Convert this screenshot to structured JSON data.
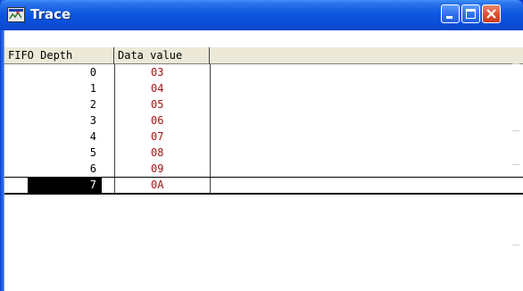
{
  "window": {
    "title": "Trace",
    "icon": "trace-window-icon",
    "buttons": [
      "minimize",
      "maximize",
      "close"
    ]
  },
  "table": {
    "columns": [
      "FIFO Depth",
      "Data value"
    ],
    "rows": [
      {
        "depth": "0",
        "value": "03"
      },
      {
        "depth": "1",
        "value": "04"
      },
      {
        "depth": "2",
        "value": "05"
      },
      {
        "depth": "3",
        "value": "06"
      },
      {
        "depth": "4",
        "value": "07"
      },
      {
        "depth": "5",
        "value": "08"
      },
      {
        "depth": "6",
        "value": "09"
      },
      {
        "depth": "7",
        "value": "0A"
      }
    ],
    "selected_row_index": 7
  },
  "colors": {
    "titlebar": "#0a4fd8",
    "value_text": "#a31515",
    "header_bg": "#ece9d8",
    "selected_bg": "#000000"
  }
}
